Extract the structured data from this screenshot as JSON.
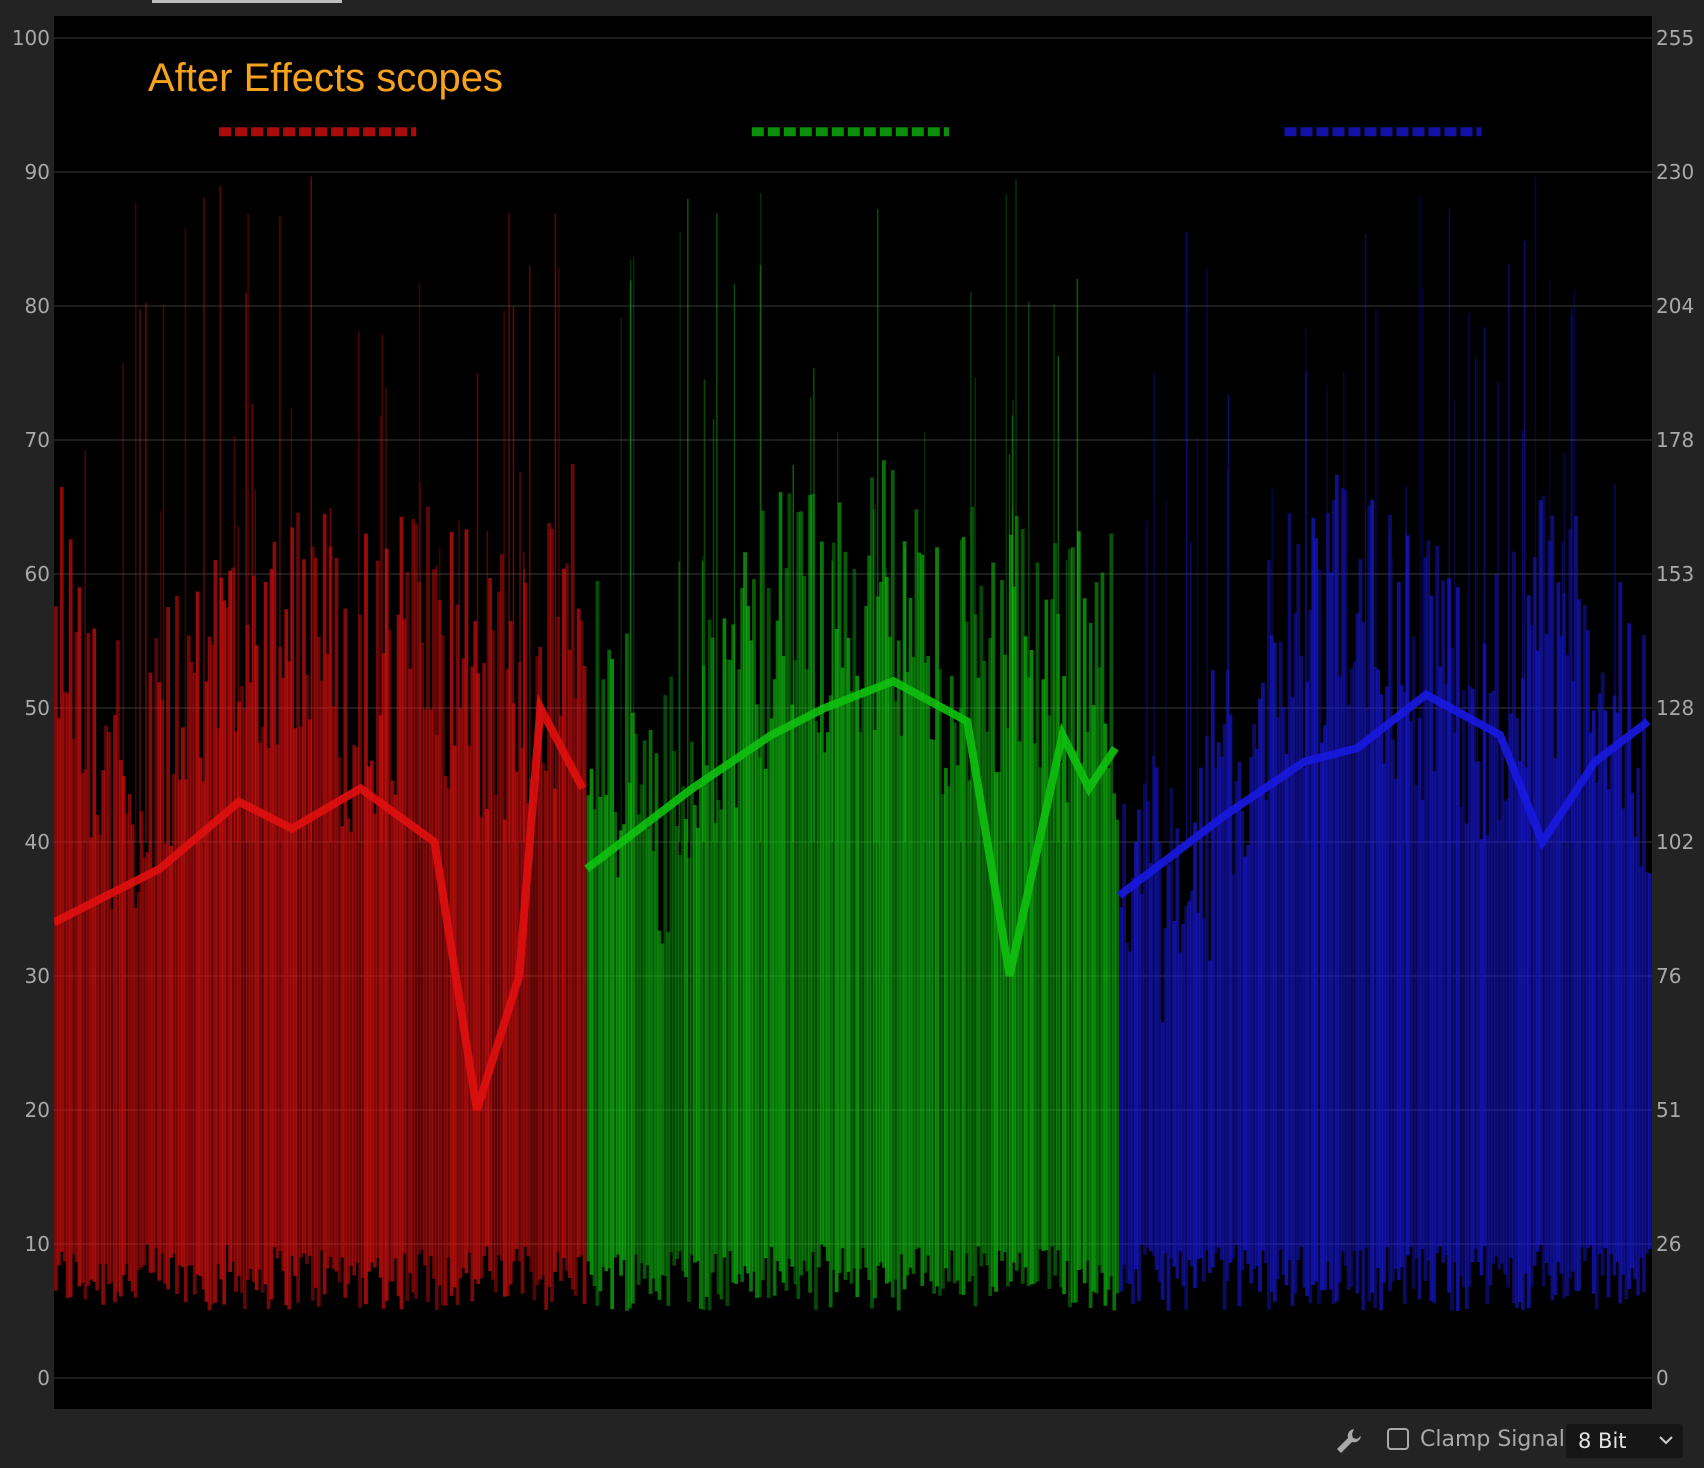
{
  "scope": {
    "title": "After Effects scopes",
    "type": "RGB parade waveform",
    "left_axis_ticks": [
      "100",
      "90",
      "80",
      "70",
      "60",
      "50",
      "40",
      "30",
      "20",
      "10",
      "0"
    ],
    "right_axis_ticks": [
      "255",
      "230",
      "204",
      "178",
      "153",
      "128",
      "102",
      "76",
      "51",
      "26",
      "0"
    ],
    "channels": [
      {
        "name": "red",
        "color": "#e01010"
      },
      {
        "name": "green",
        "color": "#10c010"
      },
      {
        "name": "blue",
        "color": "#1818e0"
      }
    ]
  },
  "toolbar": {
    "wrench_icon": "wrench-icon",
    "clamp_signal_label": "Clamp Signal",
    "clamp_signal_checked": false,
    "bit_depth_value": "8 Bit"
  }
}
